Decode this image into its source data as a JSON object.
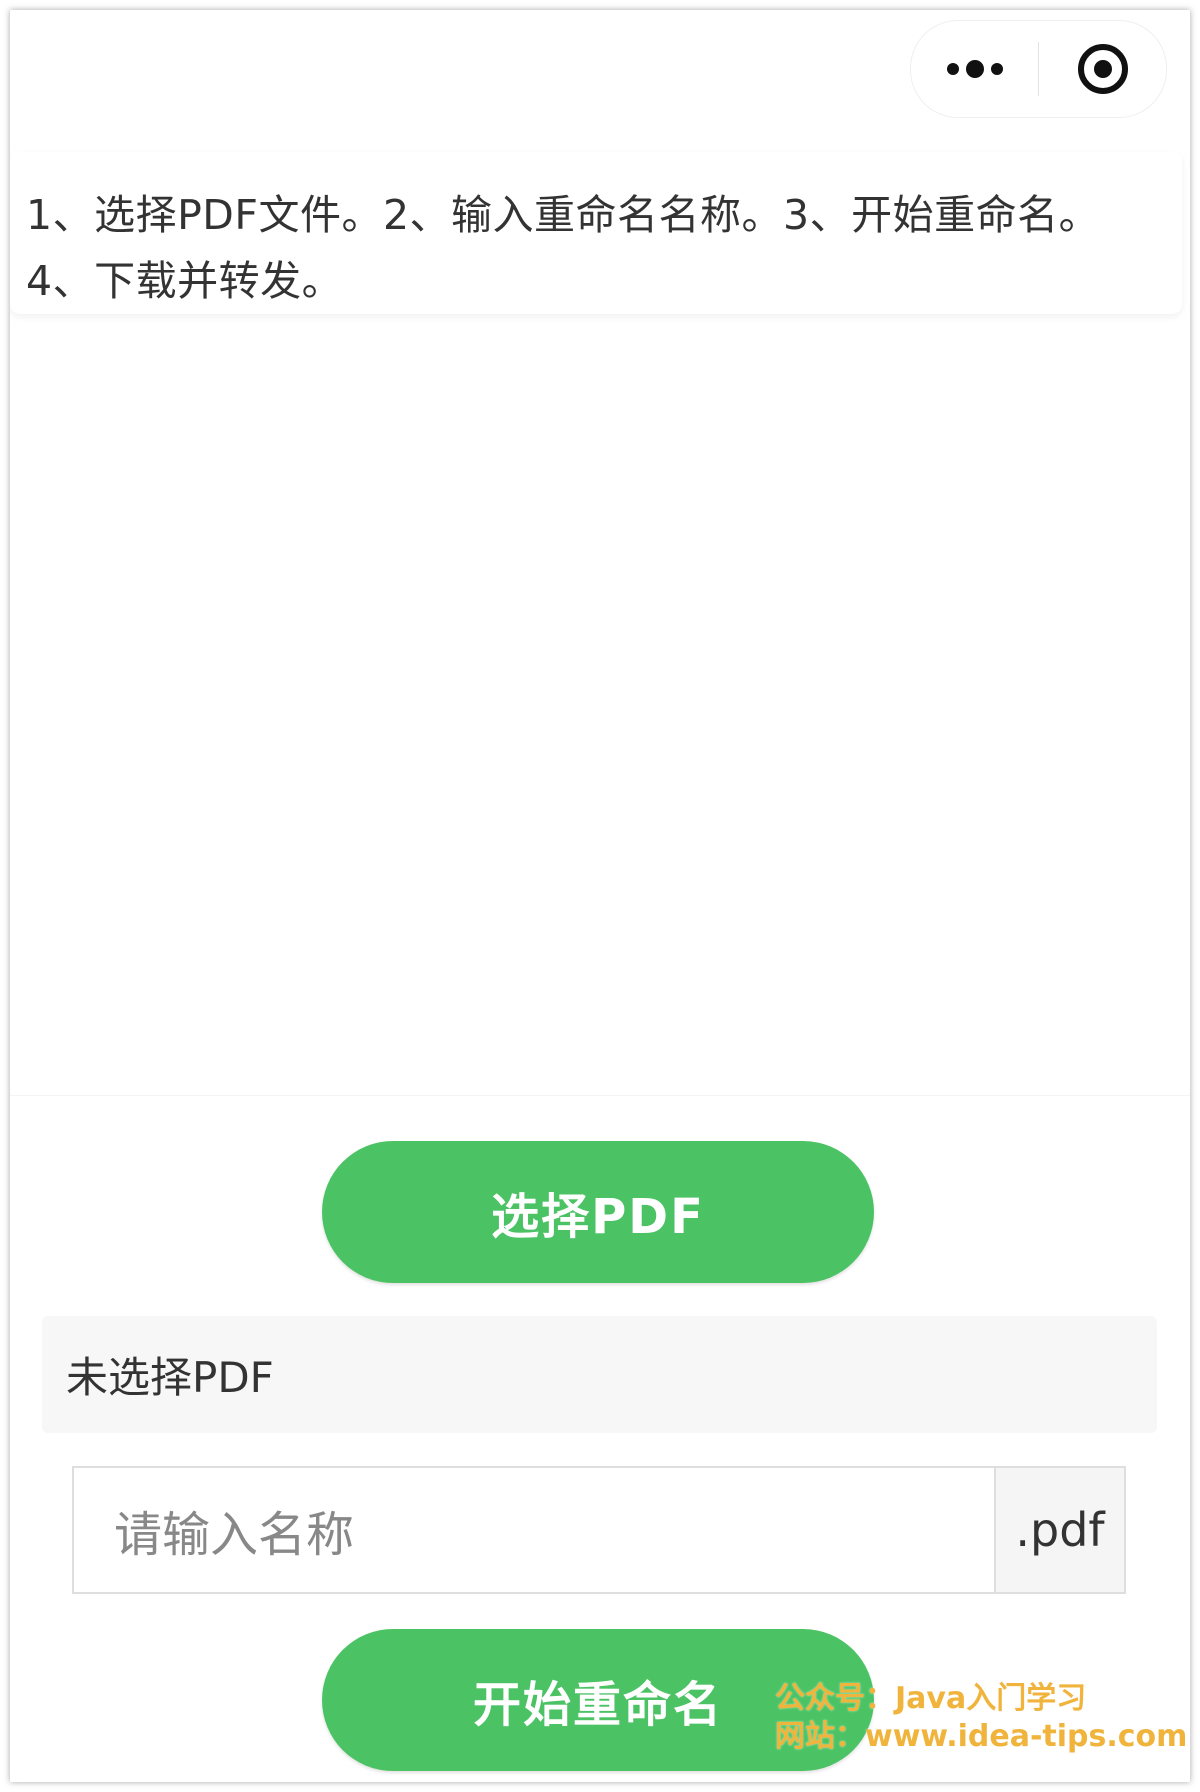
{
  "header": {
    "menu_icon": "more-dots-icon",
    "close_icon": "target-circle-icon"
  },
  "instructions": {
    "text": "1、选择PDF文件。2、输入重命名名称。3、开始重命名。4、下载并转发。"
  },
  "actions": {
    "select_pdf_label": "选择PDF",
    "status_text": "未选择PDF",
    "name_placeholder": "请输入名称",
    "suffix": ".pdf",
    "rename_label": "开始重命名"
  },
  "watermark": {
    "line1": "公众号：Java入门学习",
    "line2": "网站：www.idea-tips.com"
  },
  "colors": {
    "accent_green": "#4bc365",
    "watermark_orange": "#f0b43c"
  }
}
